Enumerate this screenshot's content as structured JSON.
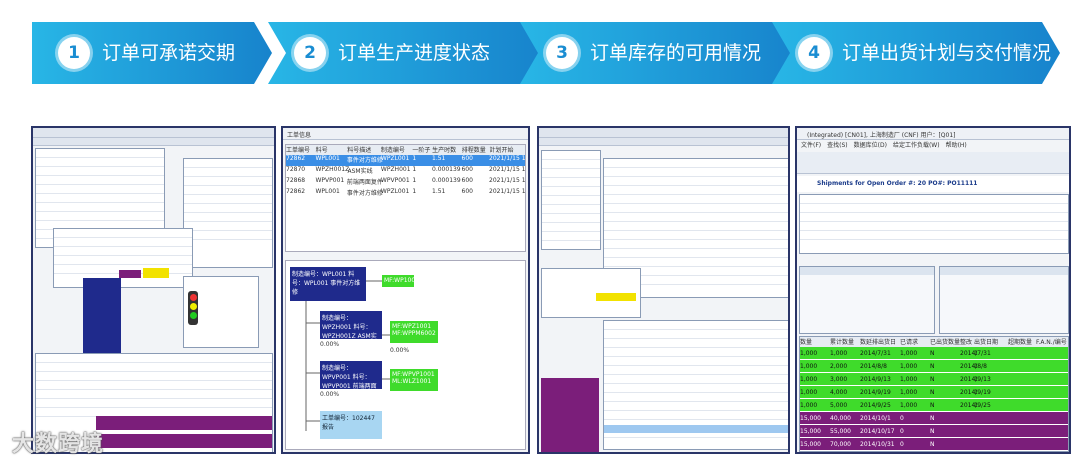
{
  "steps": [
    {
      "num": "1",
      "label": "订单可承诺交期"
    },
    {
      "num": "2",
      "label": "订单生产进度状态"
    },
    {
      "num": "3",
      "label": "订单库存的可用情况"
    },
    {
      "num": "4",
      "label": "订单出货计划与交付情况"
    }
  ],
  "panel2": {
    "window_title": "工单信息",
    "columns": [
      "工单编号",
      "料号",
      "料号描述",
      "制造编号",
      "一阶子",
      "生产时数",
      "排程数量",
      "計划开始"
    ],
    "rows": [
      [
        "72862",
        "WPL001",
        "事件对方维修",
        "WPZL001",
        "1",
        "1.51",
        "600",
        "2021/1/15 1"
      ],
      [
        "72870",
        "WPZH001Z",
        "ASM实线",
        "WPZH001",
        "1",
        "0.000139",
        "600",
        "2021/1/15 1"
      ],
      [
        "72868",
        "WPVP001",
        "前端两面复件",
        "WPVP001",
        "1",
        "0.000139",
        "600",
        "2021/1/15 1"
      ],
      [
        "72862",
        "WPL001",
        "事件对方维修",
        "WPZL001",
        "1",
        "1.51",
        "600",
        "2021/1/15 1"
      ]
    ],
    "tree_root": "制造编号：WPL001 料号：WPL001 事件对方维修",
    "tree_nodes": [
      "制造编号：WPZH001 料号：WPZH001Z ASM实线",
      "制造编号：WPVP001 料号：WPVP001 前端两面复件",
      "工单编号：102447 报告"
    ],
    "green_nodes": [
      "MF:WP1001",
      "MF:WPZ1001 MF:WPPM6002",
      "MF:WPVP1001 ML:WLZ1001"
    ],
    "percents": [
      "0.00%",
      "0.00%",
      "0.00%"
    ]
  },
  "panel4": {
    "title_bar": "(Integrated) [CN01], 上海制造厂 (CNF) 用户：[Q01]",
    "menu": [
      "文件(F)",
      "查找(S)",
      "数据库位(D)",
      "给定工作负载(W)",
      "帮助(H)"
    ],
    "doc_title": "Shipments for Open Order #: 20 PO#: PO11111",
    "table_headers": [
      "数量",
      "累计数量",
      "数延排出货日",
      "已请求",
      "已出货数量",
      "整改",
      "出货日期",
      "超期数量",
      "F.A.N./编号"
    ],
    "rows": [
      [
        "1,000",
        "1,000",
        "2014/7/31",
        "1,000",
        "N",
        "2014/7/31",
        "1"
      ],
      [
        "1,000",
        "2,000",
        "2014/8/8",
        "1,000",
        "N",
        "2014/8/8",
        "1"
      ],
      [
        "1,000",
        "3,000",
        "2014/9/13",
        "1,000",
        "N",
        "2014/9/13",
        "1"
      ],
      [
        "1,000",
        "4,000",
        "2014/9/19",
        "1,000",
        "N",
        "2014/9/19",
        "1"
      ],
      [
        "1,000",
        "5,000",
        "2014/9/25",
        "1,000",
        "N",
        "2014/9/25",
        "1"
      ],
      [
        "15,000",
        "40,000",
        "2014/10/1",
        "0",
        "N",
        "",
        ""
      ],
      [
        "15,000",
        "55,000",
        "2014/10/17",
        "0",
        "N",
        "",
        ""
      ],
      [
        "15,000",
        "70,000",
        "2014/10/31",
        "0",
        "N",
        "",
        ""
      ]
    ],
    "row_colors": [
      "#3fdb2b",
      "#3fdb2b",
      "#3fdb2b",
      "#3fdb2b",
      "#3fdb2b",
      "#7b1e7a",
      "#7b1e7a",
      "#7b1e7a"
    ]
  },
  "watermark": "大数跨境",
  "colors": {
    "banner_start": "#28b6e6",
    "banner_end": "#1783cc",
    "frame": "#2a3568",
    "green": "#3fdb2b",
    "purple": "#7b1e7a"
  }
}
